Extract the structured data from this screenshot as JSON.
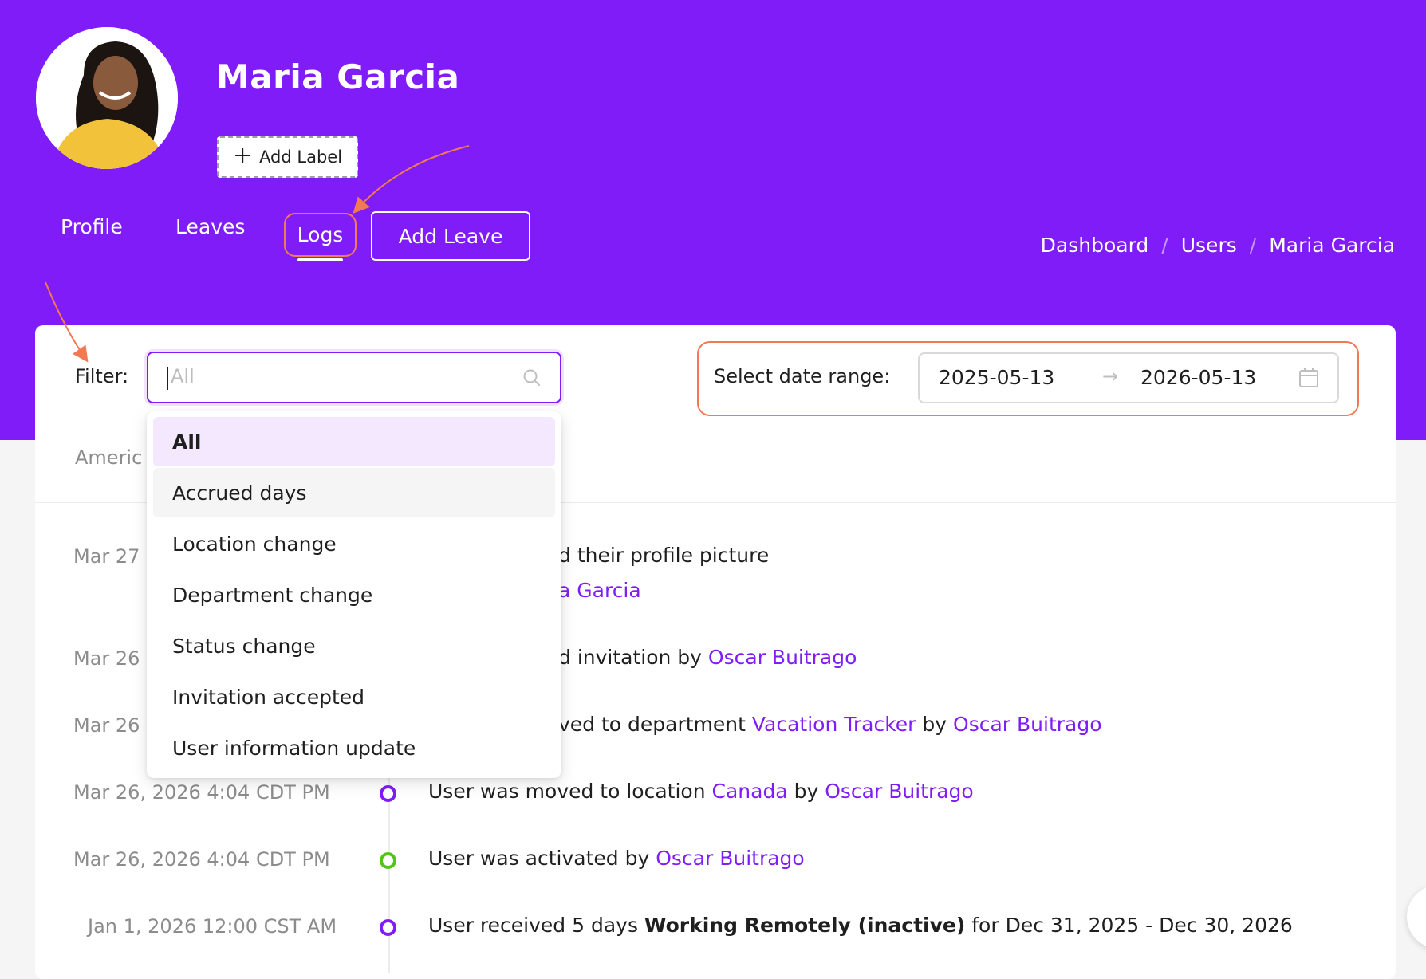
{
  "header": {
    "user_name": "Maria Garcia",
    "add_label": "Add Label",
    "tabs": [
      {
        "label": "Profile"
      },
      {
        "label": "Leaves"
      },
      {
        "label": "Logs"
      }
    ],
    "add_leave": "Add Leave",
    "breadcrumb": [
      "Dashboard",
      "Users",
      "Maria Garcia"
    ],
    "breadcrumb_separator": "/"
  },
  "filter": {
    "label": "Filter:",
    "placeholder": "All",
    "options": [
      "All",
      "Accrued days",
      "Location change",
      "Department change",
      "Status change",
      "Invitation accepted",
      "User information update"
    ],
    "selected": "All",
    "hovered": "Accrued days"
  },
  "date_range": {
    "label": "Select date range:",
    "start": "2025-05-13",
    "arrow": "→",
    "end": "2026-05-13"
  },
  "partial_text": "Americ",
  "logs": [
    {
      "time": "Mar 27",
      "text": "d their profile picture",
      "link": "a Garcia"
    },
    {
      "time": "Mar 26",
      "pre": "d invitation by ",
      "link": "Oscar Buitrago"
    },
    {
      "time": "Mar 26",
      "pre": "ved to department ",
      "link1": "Vacation Tracker",
      "mid": " by ",
      "link2": "Oscar Buitrago"
    },
    {
      "time": "Mar 26, 2026 4:04 CDT PM",
      "pre": "User was moved to location ",
      "link1": "Canada",
      "mid": " by ",
      "link2": "Oscar Buitrago",
      "dot": "purple"
    },
    {
      "time": "Mar 26, 2026 4:04 CDT PM",
      "pre": "User was activated by ",
      "link": "Oscar Buitrago",
      "dot": "green"
    },
    {
      "time": "Jan 1, 2026 12:00 CST AM",
      "pre": "User received 5 days ",
      "bold": "Working Remotely (inactive)",
      "post": " for Dec 31, 2025 - Dec 30, 2026",
      "dot": "purple"
    }
  ],
  "colors": {
    "brand": "#7f1cf8",
    "annotation": "#f27a53",
    "status_active": "#52c41a"
  },
  "icons": [
    "search-icon",
    "calendar-icon",
    "plus-icon"
  ]
}
